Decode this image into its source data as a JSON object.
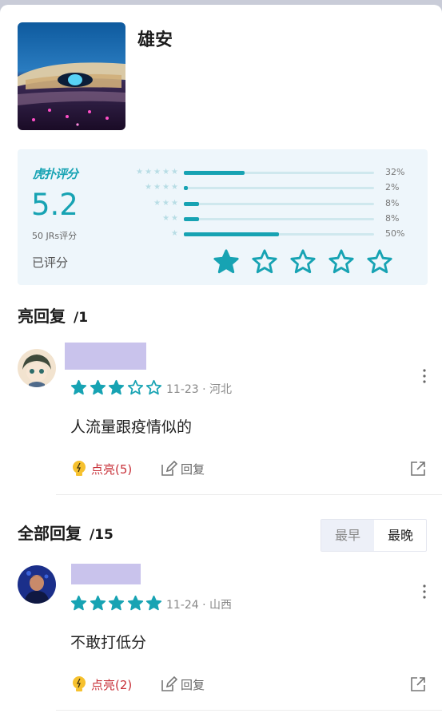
{
  "topic": {
    "title": "雄安"
  },
  "rating": {
    "label": "虎扑评分",
    "score": "5.2",
    "count_text": "50 JRs评分",
    "my_rating_label": "已评分",
    "distribution": [
      {
        "stars": 5,
        "percent_text": "32%",
        "fraction": 0.32
      },
      {
        "stars": 4,
        "percent_text": "2%",
        "fraction": 0.02
      },
      {
        "stars": 3,
        "percent_text": "8%",
        "fraction": 0.08
      },
      {
        "stars": 2,
        "percent_text": "8%",
        "fraction": 0.08
      },
      {
        "stars": 1,
        "percent_text": "50%",
        "fraction": 0.5
      }
    ],
    "my_stars": 1,
    "accent_color": "#17a3b3"
  },
  "highlight_section": {
    "title": "亮回复",
    "count": "/1",
    "replies": [
      {
        "stars": 3,
        "date": "11-23",
        "location": "河北",
        "text": "人流量跟疫情似的",
        "like_label": "点亮(5)",
        "reply_label": "回复"
      }
    ]
  },
  "all_section": {
    "title": "全部回复",
    "count": "/15",
    "sort_options": [
      "最早",
      "最晚"
    ],
    "sort_selected": "最晚",
    "replies": [
      {
        "stars": 5,
        "date": "11-24",
        "location": "山西",
        "text": "不敢打低分",
        "like_label": "点亮(2)",
        "reply_label": "回复"
      }
    ]
  },
  "meta_separator": "·",
  "icons": {
    "like": "lightbulb-icon",
    "reply": "edit-icon",
    "share": "share-icon",
    "more": "more-vertical-icon"
  }
}
